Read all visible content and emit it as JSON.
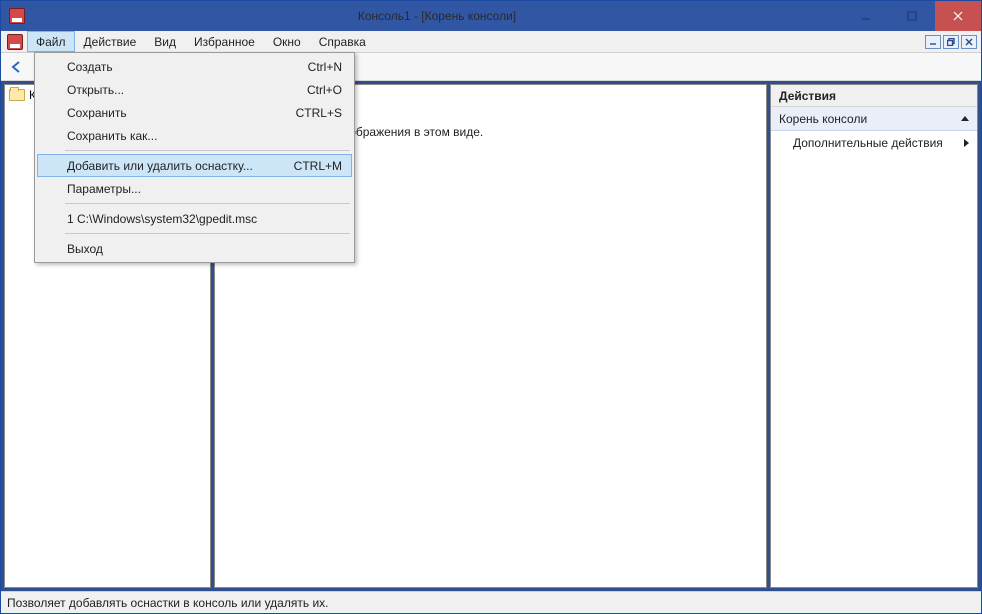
{
  "titlebar": {
    "title": "Консоль1 - [Корень консоли]"
  },
  "menubar": {
    "items": [
      "Файл",
      "Действие",
      "Вид",
      "Избранное",
      "Окно",
      "Справка"
    ]
  },
  "file_menu": {
    "create": {
      "label": "Создать",
      "shortcut": "Ctrl+N"
    },
    "open": {
      "label": "Открыть...",
      "shortcut": "Ctrl+O"
    },
    "save": {
      "label": "Сохранить",
      "shortcut": "CTRL+S"
    },
    "save_as": {
      "label": "Сохранить как..."
    },
    "add_remove": {
      "label": "Добавить или удалить оснастку...",
      "shortcut": "CTRL+M"
    },
    "options": {
      "label": "Параметры..."
    },
    "recent1": {
      "label": "1 C:\\Windows\\system32\\gpedit.msc"
    },
    "exit": {
      "label": "Выход"
    }
  },
  "tree": {
    "root": "Корень консоли"
  },
  "main": {
    "empty_text": "Нет элементов для отображения в этом виде."
  },
  "actions": {
    "header": "Действия",
    "root": "Корень консоли",
    "more": "Дополнительные действия"
  },
  "statusbar": {
    "text": "Позволяет добавлять оснастки в консоль или удалять их."
  }
}
